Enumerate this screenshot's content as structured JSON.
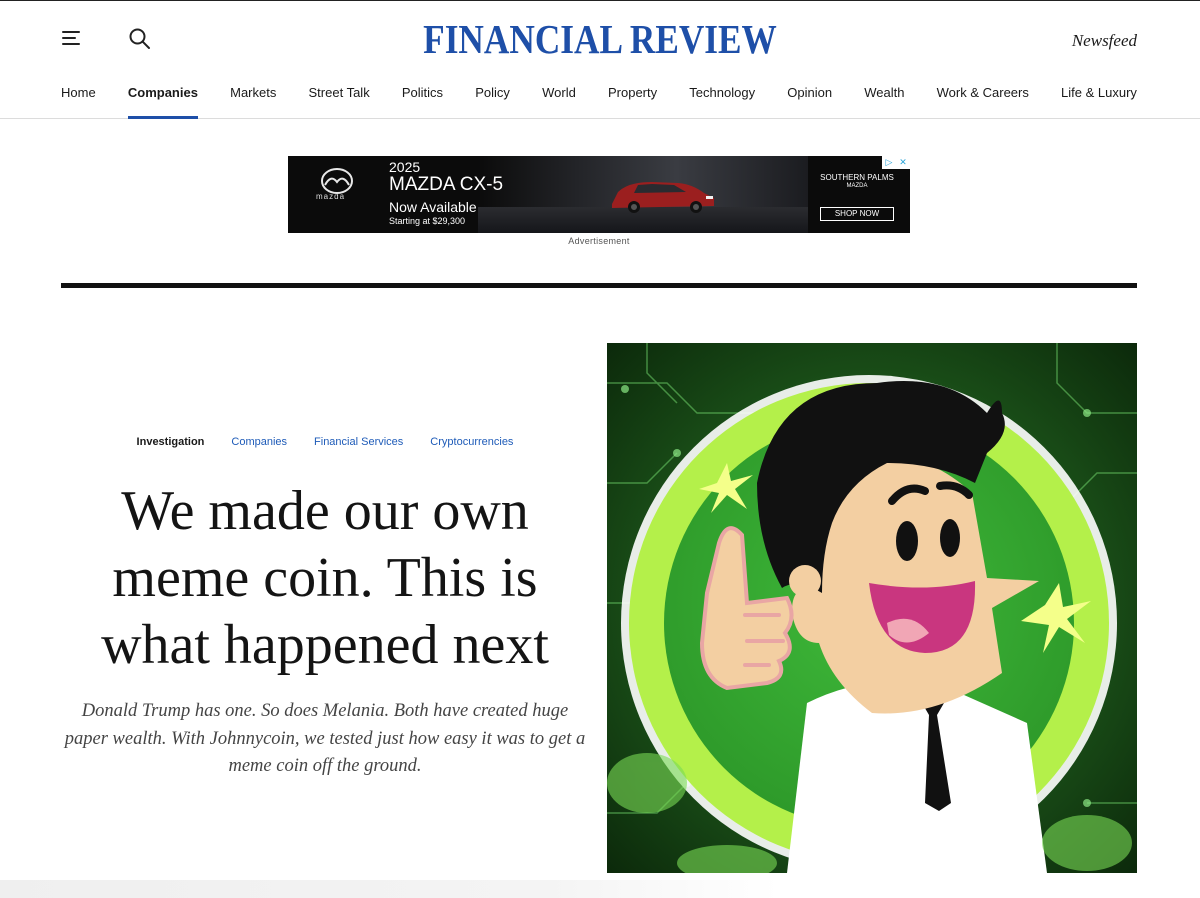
{
  "site": {
    "logo": "FINANCIAL REVIEW",
    "newsfeed_label": "Newsfeed",
    "brand_color": "#1e4fa8"
  },
  "nav": {
    "items": [
      {
        "label": "Home"
      },
      {
        "label": "Companies",
        "active": true
      },
      {
        "label": "Markets"
      },
      {
        "label": "Street Talk"
      },
      {
        "label": "Politics"
      },
      {
        "label": "Policy"
      },
      {
        "label": "World"
      },
      {
        "label": "Property"
      },
      {
        "label": "Technology"
      },
      {
        "label": "Opinion"
      },
      {
        "label": "Wealth"
      },
      {
        "label": "Work & Careers"
      },
      {
        "label": "Life & Luxury"
      }
    ]
  },
  "ad": {
    "brand_logo_text": "mazda",
    "year": "2025",
    "model": "MAZDA CX-5",
    "availability": "Now Available",
    "price": "Starting at $29,300",
    "dealer": "SOUTHERN PALMS",
    "dealer_sub": "MAZDA",
    "cta": "SHOP NOW",
    "label": "Advertisement"
  },
  "article": {
    "tags": [
      {
        "label": "Investigation",
        "primary": true
      },
      {
        "label": "Companies"
      },
      {
        "label": "Financial Services"
      },
      {
        "label": "Cryptocurrencies"
      }
    ],
    "headline": "We made our own meme coin. This is what happened next",
    "standfirst": "Donald Trump has one. So does Melania. Both have created huge paper wealth. With Johnnycoin, we tested just how easy it was to get a meme coin off the ground."
  },
  "colors": {
    "tag_link": "#1e5bb8",
    "hero_green": "#3fb93a",
    "hero_ring": "#b4f04a"
  }
}
